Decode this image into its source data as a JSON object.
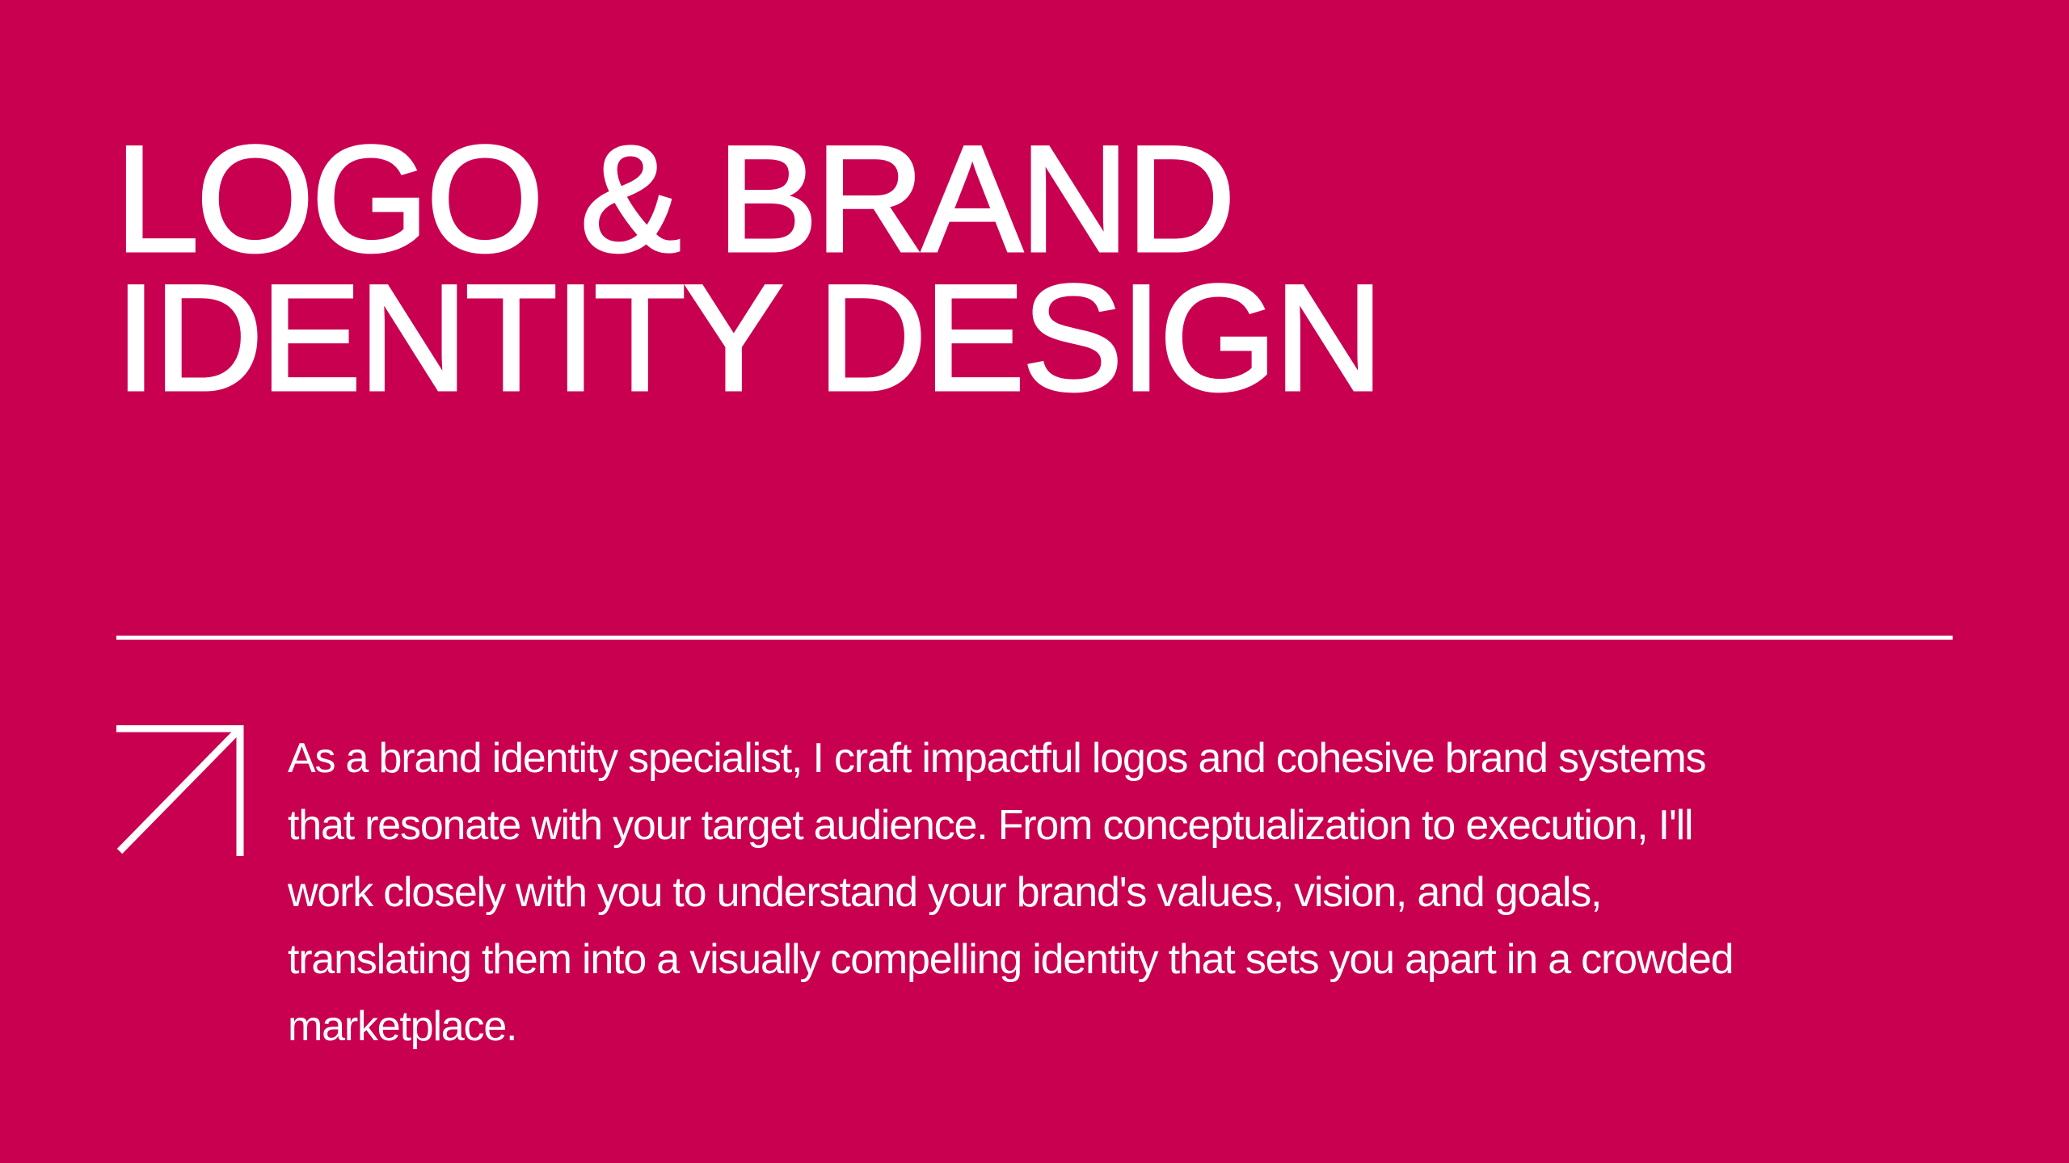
{
  "title": {
    "lines": [
      "LOGO & BRAND",
      "IDENTITY DESIGN"
    ]
  },
  "description": {
    "lines": [
      "As a brand identity specialist, I craft impactful logos and cohesive brand systems",
      "that resonate with your target audience. From conceptualization to execution, I'll",
      "work closely with you to understand your brand's values, vision, and goals,",
      "translating them into a visually compelling identity that sets you apart in a crowded",
      "marketplace."
    ]
  },
  "colors": {
    "background": "#C90050",
    "foreground": "#FFFFFF"
  },
  "icons": {
    "arrow": "arrow-up-right-icon"
  }
}
